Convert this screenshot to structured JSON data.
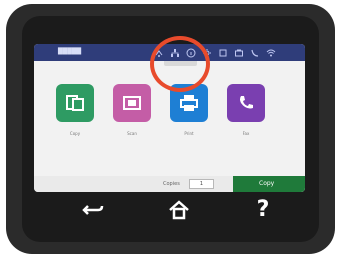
{
  "statusbar": {
    "title": "█████",
    "icons": [
      "wireless-direct-icon",
      "network-icon",
      "info-icon",
      "settings-icon",
      "ink-icon",
      "fax-icon",
      "phone-icon",
      "wifi-icon"
    ]
  },
  "apps": [
    {
      "label": "Copy",
      "color": "#2e9b63",
      "icon": "copy-icon"
    },
    {
      "label": "Scan",
      "color": "#c45da6",
      "icon": "scan-icon"
    },
    {
      "label": "Print",
      "color": "#1e7fd4",
      "icon": "print-icon"
    },
    {
      "label": "Fax",
      "color": "#7a3fb0",
      "icon": "fax-icon"
    }
  ],
  "bottom": {
    "copies_label": "Copies",
    "copies_value": "1",
    "copy_button_label": "Copy"
  },
  "nav": {
    "back_icon": "back-icon",
    "home_icon": "home-icon",
    "help_label": "?"
  },
  "colors": {
    "statusbar": "#2f3d7a",
    "highlight": "#e84b2c",
    "copy_green": "#1f7a3a"
  }
}
